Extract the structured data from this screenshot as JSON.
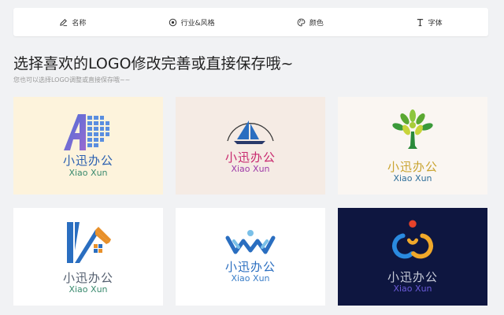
{
  "tabs": [
    {
      "label": "名称",
      "icon": "pencil-icon"
    },
    {
      "label": "行业&风格",
      "icon": "target-icon"
    },
    {
      "label": "颜色",
      "icon": "palette-icon"
    },
    {
      "label": "字体",
      "icon": "font-icon"
    }
  ],
  "heading": "选择喜欢的LOGO修改完善或直接保存哦~",
  "subheading": "您也可以选择LOGO调整或直接保存哦~~",
  "logos": [
    {
      "cn": "小迅办公",
      "en": "Xiao Xun",
      "bg": "#fdf3dc",
      "cn_color": "#2a5fb0",
      "en_color": "#3a8a6e",
      "icon": "letter-a-building-icon"
    },
    {
      "cn": "小迅办公",
      "en": "Xiao Xun",
      "bg": "#f5ebe4",
      "cn_color": "#c8286e",
      "en_color": "#9e3aa8",
      "icon": "sailboat-icon"
    },
    {
      "cn": "小迅办公",
      "en": "Xiao Xun",
      "bg": "#faf6f2",
      "cn_color": "#c9a430",
      "en_color": "#2f6f9a",
      "icon": "tree-icon"
    },
    {
      "cn": "小迅办公",
      "en": "Xiao Xun",
      "bg": "#ffffff",
      "cn_color": "#556070",
      "en_color": "#3a8a6e",
      "icon": "house-icon"
    },
    {
      "cn": "小迅办公",
      "en": "Xiao Xun",
      "bg": "#ffffff",
      "cn_color": "#2a6ec0",
      "en_color": "#3a7ec8",
      "icon": "people-wave-icon"
    },
    {
      "cn": "小迅办公",
      "en": "Xiao Xun",
      "bg": "#0e1640",
      "cn_color": "#c8ccd8",
      "en_color": "#6a5ad8",
      "icon": "rings-icon"
    }
  ]
}
